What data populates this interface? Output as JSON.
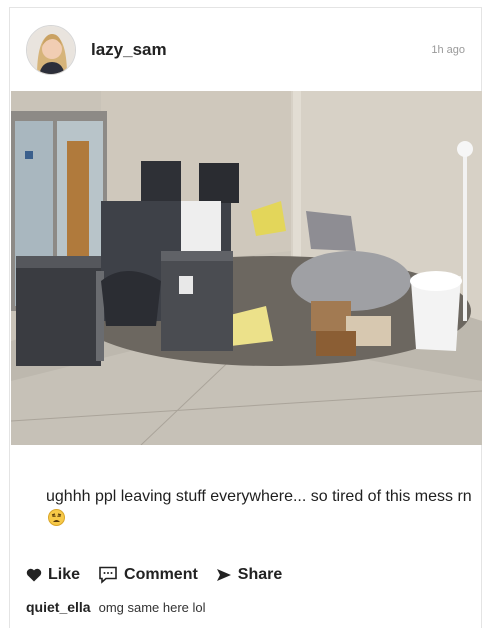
{
  "post": {
    "username": "lazy_sam",
    "time": "1h ago",
    "caption": "ughhh ppl leaving stuff everywhere... so tired of this mess rn",
    "caption_emoji": "weary-face-emoji"
  },
  "actions": {
    "like_label": "Like",
    "comment_label": "Comment",
    "share_label": "Share"
  },
  "comments": [
    {
      "user": "quiet_ella",
      "text": "omg same here lol"
    }
  ],
  "icons": {
    "like": "heart-icon",
    "comment": "speech-bubble-icon",
    "share": "send-arrow-icon"
  },
  "colors": {
    "text": "#222222",
    "muted": "#9a9a9a",
    "border": "#e4e4e4"
  }
}
